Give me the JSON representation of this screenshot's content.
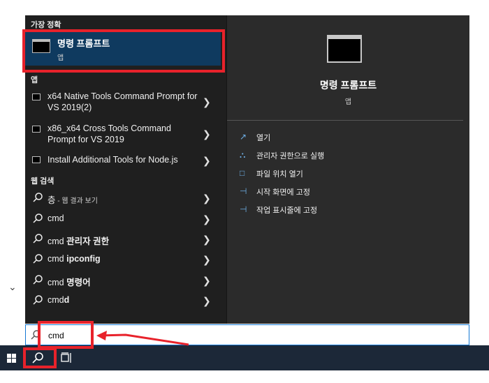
{
  "best_match": {
    "section_label": "가장 정확",
    "title": "명령 프롬프트",
    "subtitle": "앱"
  },
  "apps": {
    "section_label": "앱",
    "items": [
      {
        "label": "x64 Native Tools Command Prompt for VS 2019(2)"
      },
      {
        "label": "x86_x64 Cross Tools Command Prompt for VS 2019"
      },
      {
        "label": "Install Additional Tools for Node.js"
      }
    ]
  },
  "web_search": {
    "section_label": "웹 검색",
    "items": [
      {
        "prefix": "층",
        "bold": "",
        "suffix": " - 웹 결과 보기"
      },
      {
        "prefix": "cmd",
        "bold": "",
        "suffix": ""
      },
      {
        "prefix": "cmd ",
        "bold": "관리자 권한",
        "suffix": ""
      },
      {
        "prefix": "cmd ",
        "bold": "ipconfig",
        "suffix": ""
      },
      {
        "prefix": "cmd ",
        "bold": "명령어",
        "suffix": ""
      },
      {
        "prefix": "cmd",
        "bold": "d",
        "suffix": ""
      }
    ]
  },
  "preview": {
    "title": "명령 프롬프트",
    "subtitle": "앱",
    "actions": [
      {
        "label": "열기",
        "icon": "open-icon"
      },
      {
        "label": "관리자 권한으로 실행",
        "icon": "shield-run-icon"
      },
      {
        "label": "파일 위치 열기",
        "icon": "file-location-icon"
      },
      {
        "label": "시작 화면에 고정",
        "icon": "pin-icon"
      },
      {
        "label": "작업 표시줄에 고정",
        "icon": "pin-icon"
      }
    ]
  },
  "search": {
    "value": "cmd"
  },
  "colors": {
    "highlight": "#e8222b",
    "selection": "#0f3a5f",
    "taskbar": "#1c2838",
    "accent": "#1478d4"
  }
}
